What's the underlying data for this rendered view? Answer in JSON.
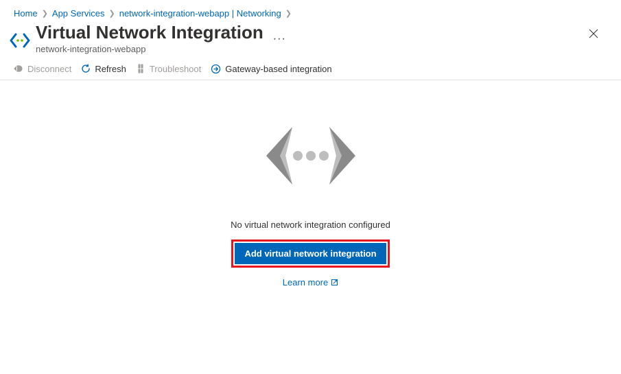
{
  "breadcrumb": {
    "items": [
      {
        "label": "Home"
      },
      {
        "label": "App Services"
      },
      {
        "label": "network-integration-webapp | Networking"
      }
    ]
  },
  "header": {
    "title": "Virtual Network Integration",
    "subtitle": "network-integration-webapp"
  },
  "toolbar": {
    "disconnect": "Disconnect",
    "refresh": "Refresh",
    "troubleshoot": "Troubleshoot",
    "gateway": "Gateway-based integration"
  },
  "empty": {
    "message": "No virtual network integration configured",
    "add_button": "Add virtual network integration",
    "learn_more": "Learn more"
  },
  "colors": {
    "link": "#0067b8",
    "primary_button": "#0067b8",
    "highlight_border": "#e8141e"
  }
}
